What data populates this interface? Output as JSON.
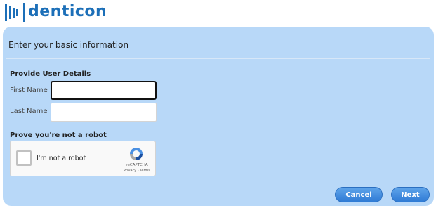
{
  "header": {
    "brand": "denticon",
    "logo_icon": "denticon-bars-icon"
  },
  "form": {
    "section_title": "Enter your basic information",
    "user_details_title": "Provide User Details",
    "first_name_label": "First Name",
    "first_name_value": "",
    "last_name_label": "Last Name",
    "last_name_value": "",
    "robot_title": "Prove you're not a robot"
  },
  "captcha": {
    "label": "I'm not a robot",
    "brand": "reCAPTCHA",
    "links": "Privacy - Terms",
    "checked": false
  },
  "buttons": {
    "cancel": "Cancel",
    "next": "Next"
  },
  "colors": {
    "brand": "#1c6fb8",
    "panel_bg": "#b8d8f8",
    "button": "#3a86dc"
  }
}
